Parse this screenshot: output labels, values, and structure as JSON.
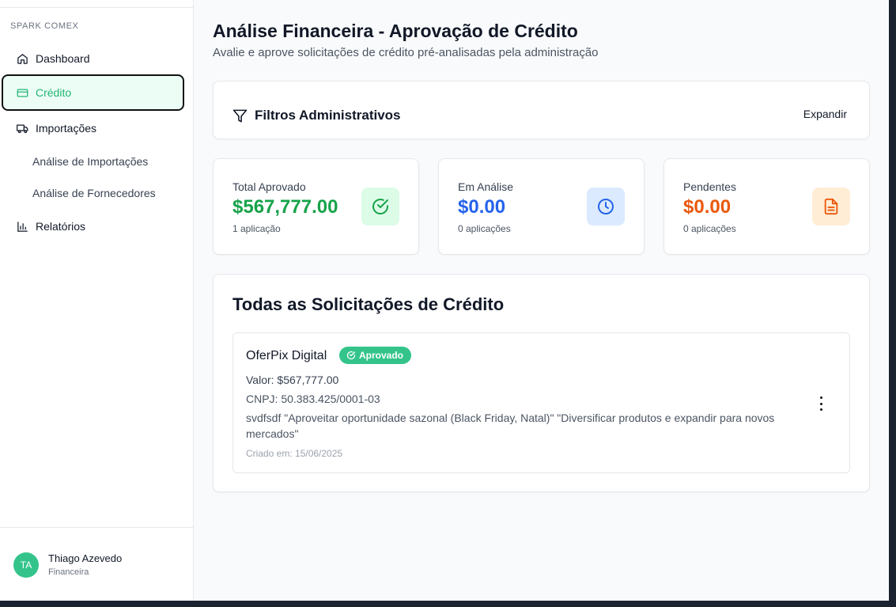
{
  "sidebar": {
    "brand": "SPARK COMEX",
    "items": [
      {
        "label": "Dashboard",
        "icon": "home-icon"
      },
      {
        "label": "Crédito",
        "icon": "credit-card-icon",
        "active": true
      },
      {
        "label": "Importações",
        "icon": "truck-icon"
      },
      {
        "label": "Análise de Importações"
      },
      {
        "label": "Análise de Fornecedores"
      },
      {
        "label": "Relatórios",
        "icon": "bar-chart-icon"
      }
    ],
    "user": {
      "initials": "TA",
      "name": "Thiago Azevedo",
      "role": "Financeira"
    }
  },
  "header": {
    "title": "Análise Financeira - Aprovação de Crédito",
    "subtitle": "Avalie e aprove solicitações de crédito pré-analisadas pela administração"
  },
  "filters": {
    "title": "Filtros Administrativos",
    "button": "Expandir"
  },
  "stats": [
    {
      "label": "Total Aprovado",
      "value": "$567,777.00",
      "count": "1 aplicação",
      "color": "#16a34a",
      "icon": "check-circle-icon",
      "icon_bg": "#dcfce7"
    },
    {
      "label": "Em Análise",
      "value": "$0.00",
      "count": "0 aplicações",
      "color": "#2563eb",
      "icon": "clock-icon",
      "icon_bg": "#dbeafe"
    },
    {
      "label": "Pendentes",
      "value": "$0.00",
      "count": "0 aplicações",
      "color": "#ea580c",
      "icon": "document-icon",
      "icon_bg": "#ffedd5"
    }
  ],
  "requests": {
    "title": "Todas as Solicitações de Crédito",
    "items": [
      {
        "company": "OferPix Digital",
        "status": "Aprovado",
        "value": "Valor: $567,777.00",
        "cnpj": "CNPJ: 50.383.425/0001-03",
        "description": "svdfsdf \"Aproveitar oportunidade sazonal (Black Friday, Natal)\" \"Diversificar produtos e expandir para novos mercados\"",
        "created": "Criado em: 15/06/2025"
      }
    ]
  },
  "colors": {
    "accent": "#34c48b",
    "active_text": "#22b573",
    "active_bg": "#ecfdf5"
  }
}
